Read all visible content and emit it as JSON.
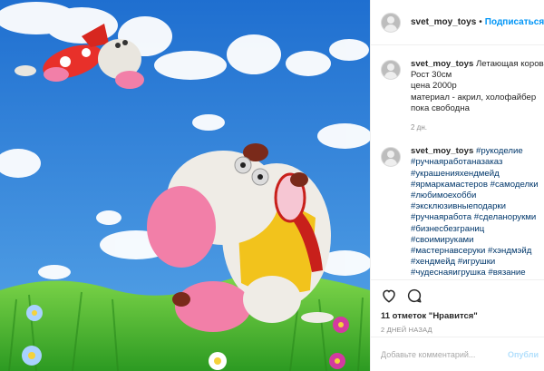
{
  "header": {
    "username": "svet_moy_toys",
    "separator": "•",
    "follow_label": "Подписаться"
  },
  "caption": {
    "username": "svet_moy_toys",
    "title": "Летающая корова",
    "lines": [
      "Рост 30см",
      "цена 2000р",
      "материал - акрил, холофайбер",
      "пока свободна"
    ],
    "time": "2 дн."
  },
  "tags_comment": {
    "username": "svet_moy_toys",
    "first_tag": "#рукоделие",
    "tags": [
      "#ручнаяработаназаказ",
      "#украшенияхендмейд",
      "#ярмаркамастеров #самоделки",
      "#любимоехобби",
      "#эксклюзивныеподарки",
      "#ручнаяработа #сделанорукми",
      "#бизнесбезграниц",
      "#своимируками",
      "#мастернавсеруки #хэндмэйд",
      "#хендмейд #игрушки",
      "#чудеснаяигрушка #вязание"
    ]
  },
  "actions": {
    "like_icon": "heart-icon",
    "comment_icon": "comment-icon",
    "likes_text": "11 отметок \"Нравится\"",
    "age_text": "2 ДНЕЙ НАЗАД"
  },
  "add_comment": {
    "placeholder": "Добавьте комментарий...",
    "publish_label": "Опубли"
  },
  "colors": {
    "sky": "#2f7fd6",
    "grass": "#3fae2a",
    "link_blue": "#0095f6",
    "hashtag_blue": "#00376b",
    "udder_pink": "#f27fa8"
  }
}
